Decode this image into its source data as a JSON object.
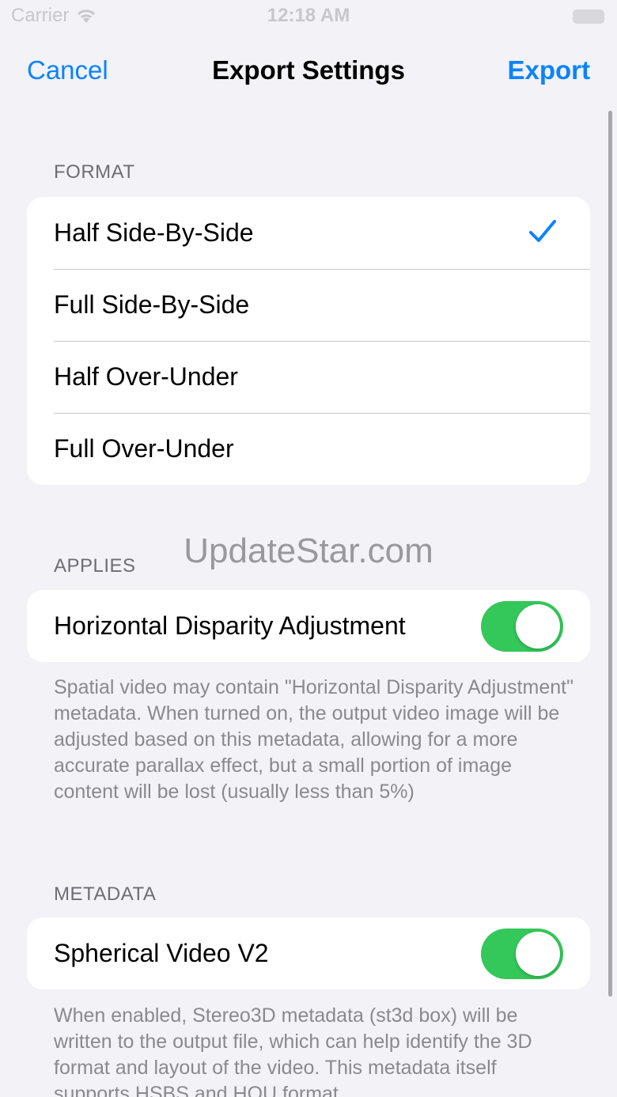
{
  "status_bar": {
    "carrier": "Carrier",
    "time": "12:18 AM"
  },
  "nav": {
    "cancel_label": "Cancel",
    "title": "Export Settings",
    "export_label": "Export"
  },
  "format": {
    "header": "FORMAT",
    "options": [
      "Half Side-By-Side",
      "Full Side-By-Side",
      "Half Over-Under",
      "Full Over-Under"
    ],
    "selected": "Half Side-By-Side"
  },
  "applies": {
    "header": "APPLIES",
    "toggle_label": "Horizontal Disparity Adjustment",
    "toggle_on": true,
    "footer": "Spatial video may contain \"Horizontal Disparity Adjustment\" metadata. When turned on, the output video image will be adjusted based on this metadata, allowing for a more accurate parallax effect, but a small portion of image content will be lost (usually less than 5%)"
  },
  "metadata": {
    "header": "METADATA",
    "toggle_label": "Spherical Video V2",
    "toggle_on": true,
    "footer": "When enabled, Stereo3D metadata (st3d box) will be written to the output file, which can help identify the 3D format and layout of the video. This metadata itself supports HSBS and HOU format"
  },
  "watermark": "UpdateStar.com",
  "colors": {
    "accent": "#0a84ff",
    "toggle_on": "#34c759",
    "background": "#f2f2f7"
  }
}
